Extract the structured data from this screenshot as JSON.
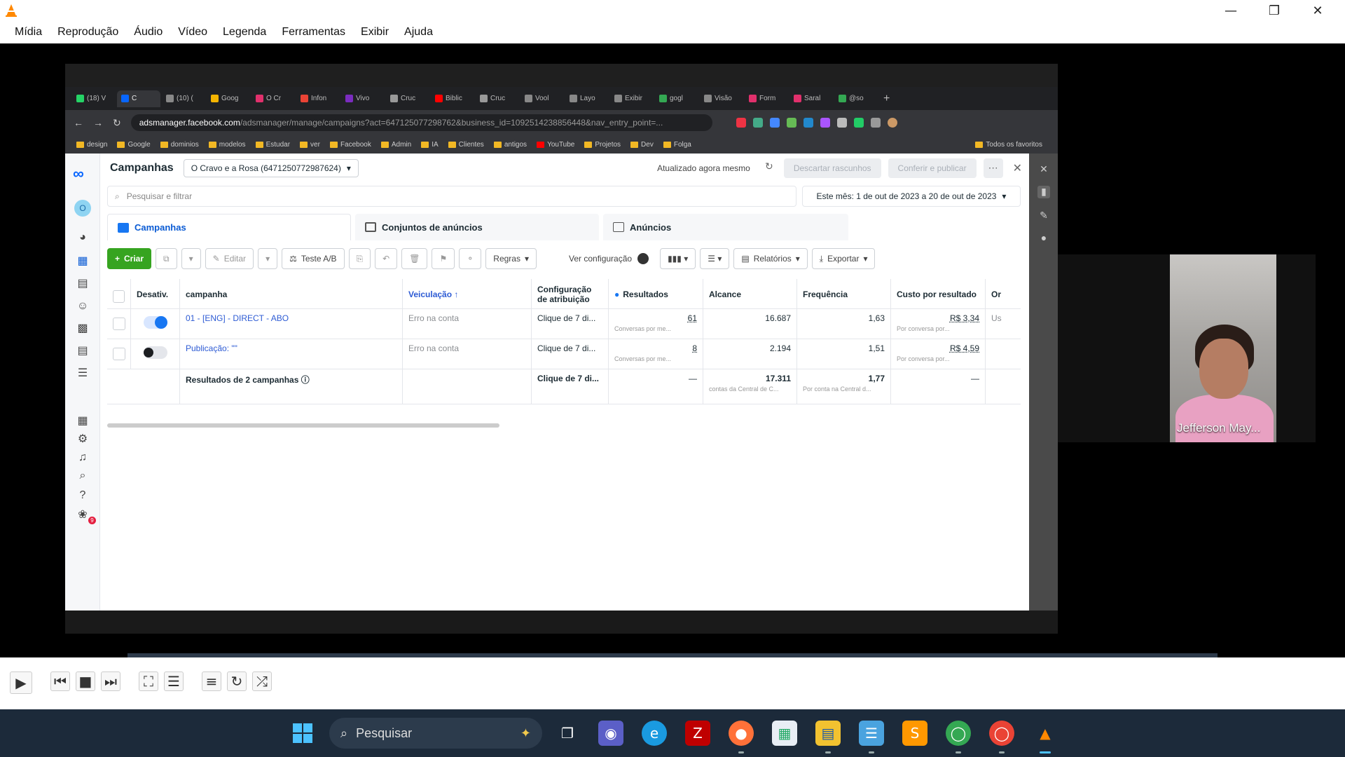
{
  "vlc": {
    "menu": [
      "Mídia",
      "Reprodução",
      "Áudio",
      "Vídeo",
      "Legenda",
      "Ferramentas",
      "Exibir",
      "Ajuda"
    ]
  },
  "browser": {
    "tabs": [
      {
        "label": "(18) V",
        "color": "#25d366"
      },
      {
        "label": "C",
        "color": "#0866ff",
        "active": true
      },
      {
        "label": "(10) (",
        "color": "#888888"
      },
      {
        "label": "Goog",
        "color": "#f4b400"
      },
      {
        "label": "O Cr",
        "color": "#e1306c"
      },
      {
        "label": "Infon",
        "color": "#ea4335"
      },
      {
        "label": "Vivo",
        "color": "#7b2cbf"
      },
      {
        "label": "Cruc",
        "color": "#999999"
      },
      {
        "label": "Biblic",
        "color": "#ff0000"
      },
      {
        "label": "Cruc",
        "color": "#999999"
      },
      {
        "label": "Vool",
        "color": "#888888"
      },
      {
        "label": "Layo",
        "color": "#888888"
      },
      {
        "label": "Exibir",
        "color": "#888888"
      },
      {
        "label": "gogl",
        "color": "#34a853"
      },
      {
        "label": "Visão",
        "color": "#888888"
      },
      {
        "label": "Form",
        "color": "#e1306c"
      },
      {
        "label": "Saral",
        "color": "#e1306c"
      },
      {
        "label": "@so",
        "color": "#34a853"
      }
    ],
    "url_host": "adsmanager.facebook.com",
    "url_rest": "/adsmanager/manage/campaigns?act=647125077298762&business_id=1092514238856448&nav_entry_point=...",
    "bookmarks": [
      "design",
      "Google",
      "dominios",
      "modelos",
      "Estudar",
      "ver",
      "Facebook",
      "Admin",
      "IA",
      "Clientes",
      "antigos",
      "YouTube",
      "Projetos",
      "Dev",
      "Folga"
    ],
    "bookmarks_right": "Todos os favoritos"
  },
  "ads": {
    "title": "Campanhas",
    "account": "O Cravo e a Rosa (647125077298762­4)",
    "updated": "Atualizado agora mesmo",
    "discard": "Descartar rascunhos",
    "publish": "Conferir e publicar",
    "search_placeholder": "Pesquisar e filtrar",
    "date_range": "Este mês: 1 de out de 2023 a 20 de out de 2023",
    "tabs": [
      "Campanhas",
      "Conjuntos de anúncios",
      "Anúncios"
    ],
    "toolbar": {
      "create": "Criar",
      "edit": "Editar",
      "ab_test": "Teste A/B",
      "rules": "Regras",
      "view_setup": "Ver configuração",
      "reports": "Relatórios",
      "export": "Exportar"
    },
    "columns": [
      "Desativ.",
      "campanha",
      "Veiculação ↑",
      "Configuração de atribuição",
      "Resultados",
      "Alcance",
      "Frequência",
      "Custo por resultado",
      "Or"
    ],
    "rows": [
      {
        "name": "01 - [ENG] - DIRECT - ABO",
        "delivery": "Erro na conta",
        "attribution": "Clique de 7 di...",
        "results": "61",
        "results_sub": "Conversas por me...",
        "reach": "16.687",
        "frequency": "1,63",
        "cpr": "R$ 3,34",
        "cpr_sub": "Por conversa por...",
        "extra": "Us"
      },
      {
        "name": "Publicação: \"\"",
        "delivery": "Erro na conta",
        "attribution": "Clique de 7 di...",
        "results": "8",
        "results_sub": "Conversas por me...",
        "reach": "2.194",
        "frequency": "1,51",
        "cpr": "R$ 4,59",
        "cpr_sub": "Por conversa por..."
      }
    ],
    "totals": {
      "label": "Resultados de 2 campanhas",
      "attribution": "Clique de 7 di...",
      "results": "—",
      "reach": "17.311",
      "reach_sub": "contas da Central de C...",
      "frequency": "1,77",
      "frequency_sub": "Por conta na Central d...",
      "cpr": "—"
    },
    "notification_count": "9"
  },
  "webcam": {
    "name": "Jefferson May..."
  },
  "taskbar": {
    "search": "Pesquisar"
  }
}
